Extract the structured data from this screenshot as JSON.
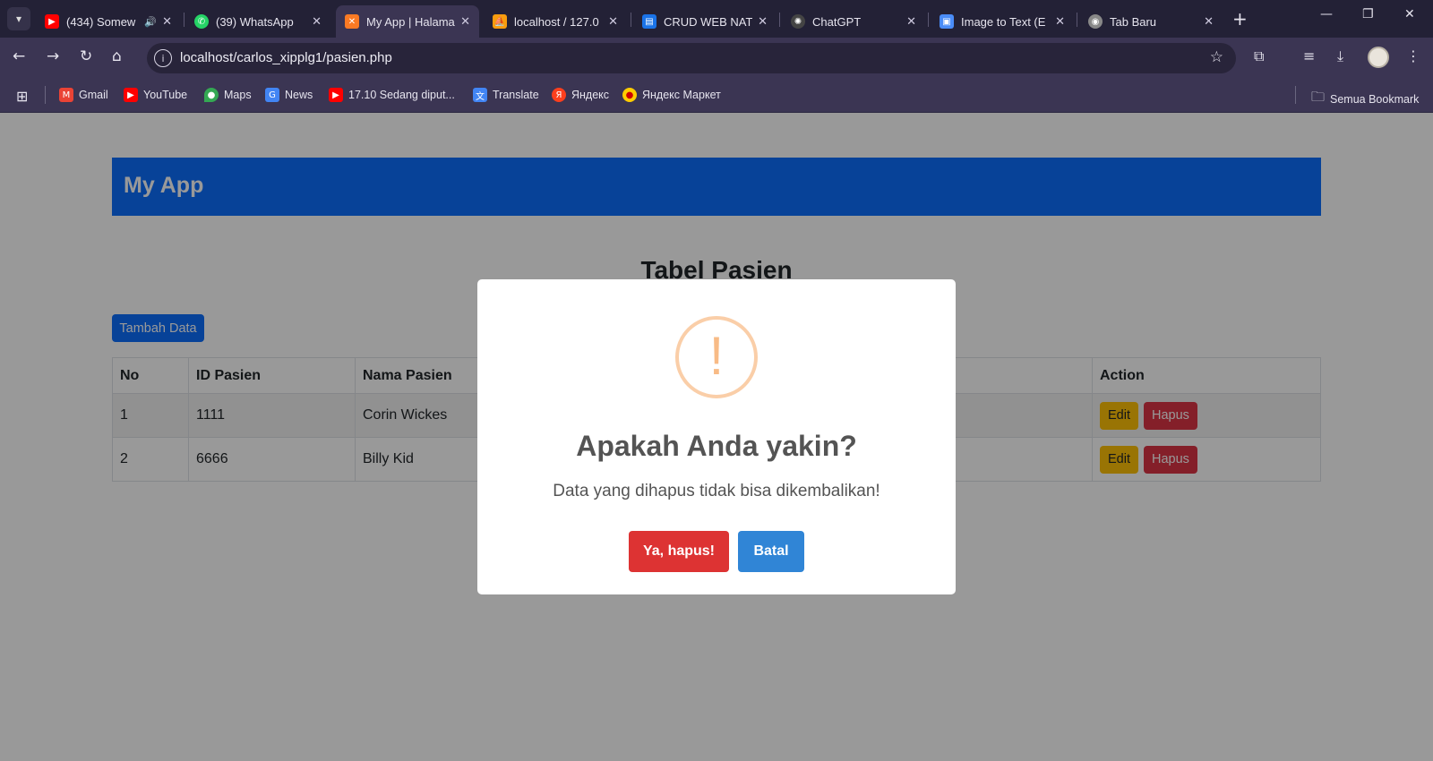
{
  "browser": {
    "tabs": [
      {
        "title": "(434) Somew",
        "icon": "youtube-icon",
        "color": "#ff0000",
        "muted_icon": "🔊"
      },
      {
        "title": "(39) WhatsApp",
        "icon": "whatsapp-icon",
        "color": "#25d366"
      },
      {
        "title": "My App | Halama",
        "icon": "xampp-icon",
        "color": "#fb7a24",
        "active": true
      },
      {
        "title": "localhost / 127.0",
        "icon": "phpmyadmin-icon",
        "color": "#f89c0e"
      },
      {
        "title": "CRUD WEB NATI",
        "icon": "docs-icon",
        "color": "#1a73e8"
      },
      {
        "title": "ChatGPT",
        "icon": "chatgpt-icon",
        "color": "#444444"
      },
      {
        "title": "Image to Text (E",
        "icon": "page-icon",
        "color": "#4a8cf7"
      },
      {
        "title": "Tab Baru",
        "icon": "chrome-icon",
        "color": "#888888"
      }
    ],
    "url": "localhost/carlos_xipplg1/pasien.php",
    "bookmarks": [
      {
        "label": "Gmail",
        "color": "#ea4335"
      },
      {
        "label": "YouTube",
        "color": "#ff0000"
      },
      {
        "label": "Maps",
        "color": "#34a853"
      },
      {
        "label": "News",
        "color": "#4285f4"
      },
      {
        "label": "17.10 Sedang diput...",
        "color": "#ff0000"
      },
      {
        "label": "Translate",
        "color": "#4285f4"
      },
      {
        "label": "Яндекс",
        "color": "#fc3f1d"
      },
      {
        "label": "Яндекс Маркет",
        "color": "#ffcc00"
      }
    ],
    "all_bookmarks": "Semua Bookmark"
  },
  "app": {
    "brand": "My App",
    "heading": "Tabel Pasien",
    "add_button": "Tambah Data",
    "table": {
      "headers": [
        "No",
        "ID Pasien",
        "Nama Pasien",
        "Action"
      ],
      "rows": [
        {
          "no": "1",
          "id": "1111",
          "name": "Corin Wickes"
        },
        {
          "no": "2",
          "id": "6666",
          "name": "Billy Kid"
        }
      ],
      "edit_label": "Edit",
      "delete_label": "Hapus"
    }
  },
  "dialog": {
    "icon": "!",
    "title": "Apakah Anda yakin?",
    "text": "Data yang dihapus tidak bisa dikembalikan!",
    "confirm": "Ya, hapus!",
    "cancel": "Batal"
  }
}
